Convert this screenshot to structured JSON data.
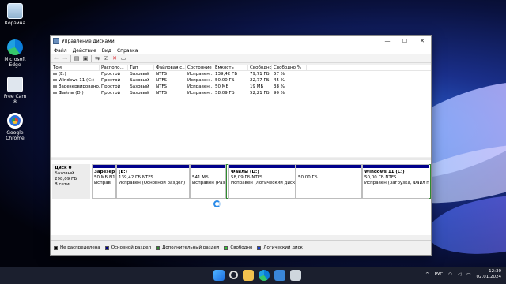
{
  "desktop": {
    "icons": [
      {
        "label": "Корзина",
        "icon": "recycle-bin-icon"
      },
      {
        "label": "Microsoft Edge",
        "icon": "edge-icon"
      },
      {
        "label": "Free Cam 8",
        "icon": "freecam-icon"
      },
      {
        "label": "Google Chrome",
        "icon": "chrome-icon"
      }
    ]
  },
  "window": {
    "title": "Управление дисками",
    "menu": [
      "Файл",
      "Действие",
      "Вид",
      "Справка"
    ],
    "controls": {
      "minimize": "—",
      "maximize": "☐",
      "close": "✕"
    }
  },
  "volumes": {
    "columns": [
      "Том",
      "Располо...",
      "Тип",
      "Файловая с...",
      "Состояние",
      "Емкость",
      "Свободно...",
      "Свободно %"
    ],
    "rows": [
      [
        "(E:)",
        "Простой",
        "Базовый",
        "NTFS",
        "Исправен...",
        "139,42 ГБ",
        "79,71 ГБ",
        "57 %"
      ],
      [
        "Windows 11 (C:)",
        "Простой",
        "Базовый",
        "NTFS",
        "Исправен...",
        "50,00 ГБ",
        "22,77 ГБ",
        "45 %"
      ],
      [
        "Зарезервировано...",
        "Простой",
        "Базовый",
        "NTFS",
        "Исправен...",
        "50 МБ",
        "19 МБ",
        "38 %"
      ],
      [
        "Файлы (D:)",
        "Простой",
        "Базовый",
        "NTFS",
        "Исправен...",
        "58,09 ГБ",
        "52,21 ГБ",
        "90 %"
      ]
    ]
  },
  "disk": {
    "name": "Диск 0",
    "type": "Базовый",
    "size": "298,09 ГБ",
    "status": "В сети",
    "partitions": [
      {
        "name": "Зарезер",
        "size": "50 МБ N1",
        "state": "Исправ"
      },
      {
        "name": "(E:)",
        "size": "139,42 ГБ NTFS",
        "state": "Исправен (Основной раздел)"
      },
      {
        "name": "",
        "size": "541 МБ",
        "state": "Исправен (Разде"
      },
      {
        "name": "Файлы  (D:)",
        "size": "58,09 ГБ NTFS",
        "state": "Исправен (Логический диск)"
      },
      {
        "name": "",
        "size": "50,00 ГБ",
        "state": ""
      },
      {
        "name": "Windows 11  (C:)",
        "size": "50,00 ГБ NTFS",
        "state": "Исправен (Загрузка, Файл по"
      }
    ]
  },
  "legend": [
    {
      "label": "Не распределена",
      "color": "#000000"
    },
    {
      "label": "Основной раздел",
      "color": "#00008b"
    },
    {
      "label": "Дополнительный раздел",
      "color": "#2e8b2e"
    },
    {
      "label": "Свободно",
      "color": "#33cc33"
    },
    {
      "label": "Логический диск",
      "color": "#1a3fd6"
    }
  ],
  "taskbar": {
    "lang": "РУС",
    "time": "12:30",
    "date": "02.01.2024"
  }
}
